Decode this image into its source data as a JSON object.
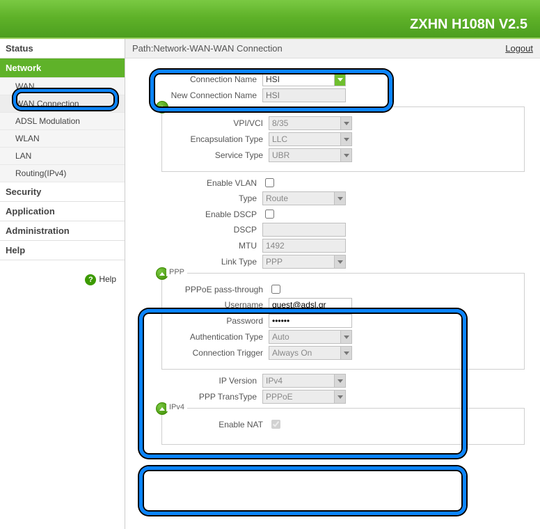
{
  "banner": {
    "title": "ZXHN H108N V2.5"
  },
  "path": "Path:Network-WAN-WAN Connection",
  "logout": "Logout",
  "sidebar": {
    "cats": [
      {
        "label": "Status"
      },
      {
        "label": "Network",
        "active": true
      },
      {
        "label": "Security"
      },
      {
        "label": "Application"
      },
      {
        "label": "Administration"
      },
      {
        "label": "Help"
      }
    ],
    "network_subs": [
      {
        "label": "WAN"
      },
      {
        "label": "WAN Connection",
        "active": true
      },
      {
        "label": "ADSL Modulation"
      },
      {
        "label": "WLAN"
      },
      {
        "label": "LAN"
      },
      {
        "label": "Routing(IPv4)"
      }
    ],
    "help": "Help"
  },
  "form": {
    "connection_name_lbl": "Connection Name",
    "connection_name": "HSI",
    "new_conn_lbl": "New Connection Name",
    "new_conn_ph": "HSI",
    "vpivci_lbl": "VPI/VCI",
    "vpivci": "8/35",
    "encap_lbl": "Encapsulation Type",
    "encap": "LLC",
    "service_lbl": "Service Type",
    "service": "UBR",
    "enable_vlan_lbl": "Enable VLAN",
    "type_lbl": "Type",
    "type": "Route",
    "enable_dscp_lbl": "Enable DSCP",
    "dscp_lbl": "DSCP",
    "dscp": "",
    "mtu_lbl": "MTU",
    "mtu": "1492",
    "linktype_lbl": "Link Type",
    "linktype": "PPP",
    "ppp_legend": "PPP",
    "pppoe_pt_lbl": "PPPoE pass-through",
    "username_lbl": "Username",
    "username": "guest@adsl.gr",
    "password_lbl": "Password",
    "password": "••••••",
    "authtype_lbl": "Authentication Type",
    "authtype": "Auto",
    "conntrig_lbl": "Connection Trigger",
    "conntrig": "Always On",
    "ipver_lbl": "IP Version",
    "ipver": "IPv4",
    "ppp_trans_lbl": "PPP TransType",
    "ppp_trans": "PPPoE",
    "ipv4_legend": "IPv4",
    "enable_nat_lbl": "Enable NAT"
  }
}
